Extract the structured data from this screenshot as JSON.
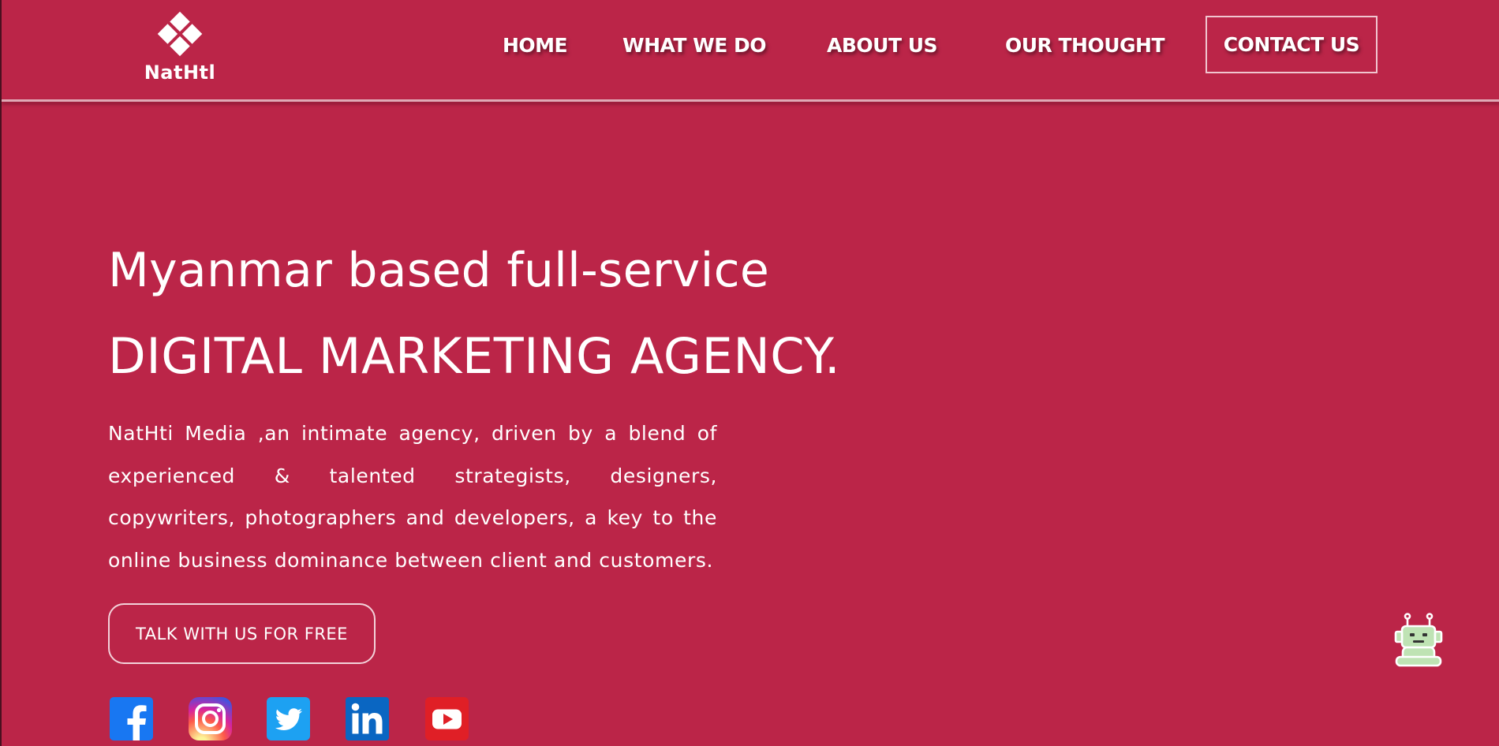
{
  "brand": {
    "logo_text": "NatHtl",
    "accent_color": "#bb2548"
  },
  "nav": {
    "items": [
      {
        "label": "HOME"
      },
      {
        "label": "WHAT WE DO"
      },
      {
        "label": "ABOUT US"
      },
      {
        "label": "OUR THOUGHT"
      }
    ],
    "contact_label": "CONTACT US"
  },
  "hero": {
    "subtitle": "Myanmar based full-service",
    "title": "DIGITAL MARKETING AGENCY.",
    "description": "NatHti Media ,an intimate agency, driven by a blend of experienced & talented strategists, designers, copywriters, photographers and developers, a key to the online business dominance between client and customers.",
    "cta_label": "TALK WITH US FOR FREE"
  },
  "social": [
    {
      "icon": "facebook-icon",
      "color": "#1877f2"
    },
    {
      "icon": "instagram-icon",
      "color": "#d6249f"
    },
    {
      "icon": "twitter-icon",
      "color": "#1da1f2"
    },
    {
      "icon": "linkedin-icon",
      "color": "#0a66c2"
    },
    {
      "icon": "youtube-icon",
      "color": "#ff0000"
    }
  ],
  "chatbot": {
    "icon": "chatbot-robot-icon",
    "color": "#bfe3b4"
  }
}
